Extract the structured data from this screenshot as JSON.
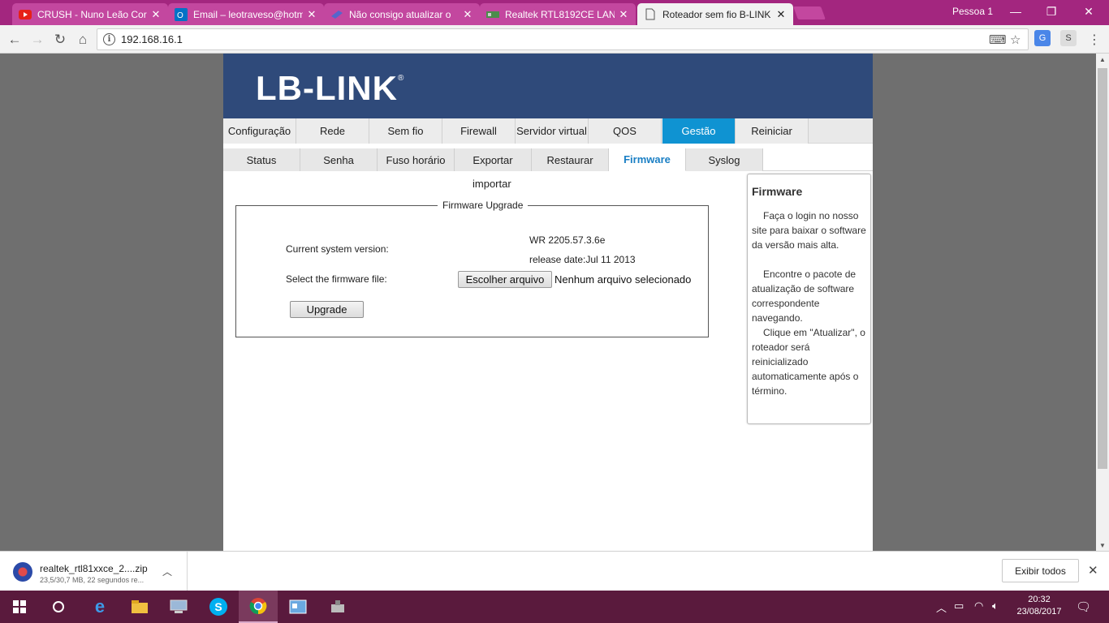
{
  "browser": {
    "tabs": [
      {
        "title": "CRUSH - Nuno Leão Cor",
        "icon": "youtube-icon"
      },
      {
        "title": "Email – leotraveso@hotm",
        "icon": "outlook-icon"
      },
      {
        "title": "Não consigo atualizar o",
        "icon": "forum-icon"
      },
      {
        "title": "Realtek RTL8192CE LAN",
        "icon": "network-card-icon"
      },
      {
        "title": "Roteador sem fio B-LINK",
        "icon": "page-icon",
        "active": true
      }
    ],
    "profile": "Pessoa 1",
    "url": "192.168.16.1",
    "tab_close": "✕",
    "extensions": [
      "translate-icon",
      "google-translate-icon",
      "s-extension-icon"
    ]
  },
  "router": {
    "logo": "LB-LINK",
    "logo_mark": "®",
    "main_nav": [
      "Configuração",
      "Rede",
      "Sem fio",
      "Firewall",
      "Servidor virtual",
      "QOS",
      "Gestão",
      "Reiniciar"
    ],
    "main_nav_active": "Gestão",
    "sub_nav": [
      "Status",
      "Senha",
      "Fuso horário",
      "Exportar",
      "Restaurar",
      "Firmware",
      "Syslog"
    ],
    "sub_nav_active": "Firmware",
    "importar": "importar",
    "fieldset_legend": "Firmware Upgrade",
    "current_version_label": "Current system version:",
    "version_value": "WR 2205.57.3.6e",
    "release_date": "release date:Jul 11 2013",
    "select_file_label": "Select the firmware file:",
    "file_button": "Escolher arquivo",
    "file_status": "Nenhum arquivo selecionado",
    "upgrade_button": "Upgrade",
    "help": {
      "title": "Firmware",
      "p1": "Faça o login no nosso site para baixar o software da versão mais alta.",
      "p2": "Encontre o pacote de atualização de software correspondente navegando.",
      "p3": "Clique em \"Atualizar\", o roteador será reinicializado automaticamente após o término."
    }
  },
  "download": {
    "filename": "realtek_rtl81xxce_2....zip",
    "status": "23,5/30,7 MB, 22 segundos re...",
    "show_all": "Exibir todos"
  },
  "taskbar": {
    "apps": [
      "start-icon",
      "cortana-icon",
      "edge-icon",
      "file-explorer-icon",
      "computer-icon",
      "skype-icon",
      "chrome-icon",
      "control-panel-icon",
      "device-icon"
    ],
    "active_app": "chrome-icon",
    "time": "20:32",
    "date": "23/08/2017"
  },
  "colors": {
    "tabstrip": "#a3267f",
    "banner": "#2f4a7a",
    "nav_active": "#0f93d2",
    "taskbar": "#5a1a3d"
  }
}
